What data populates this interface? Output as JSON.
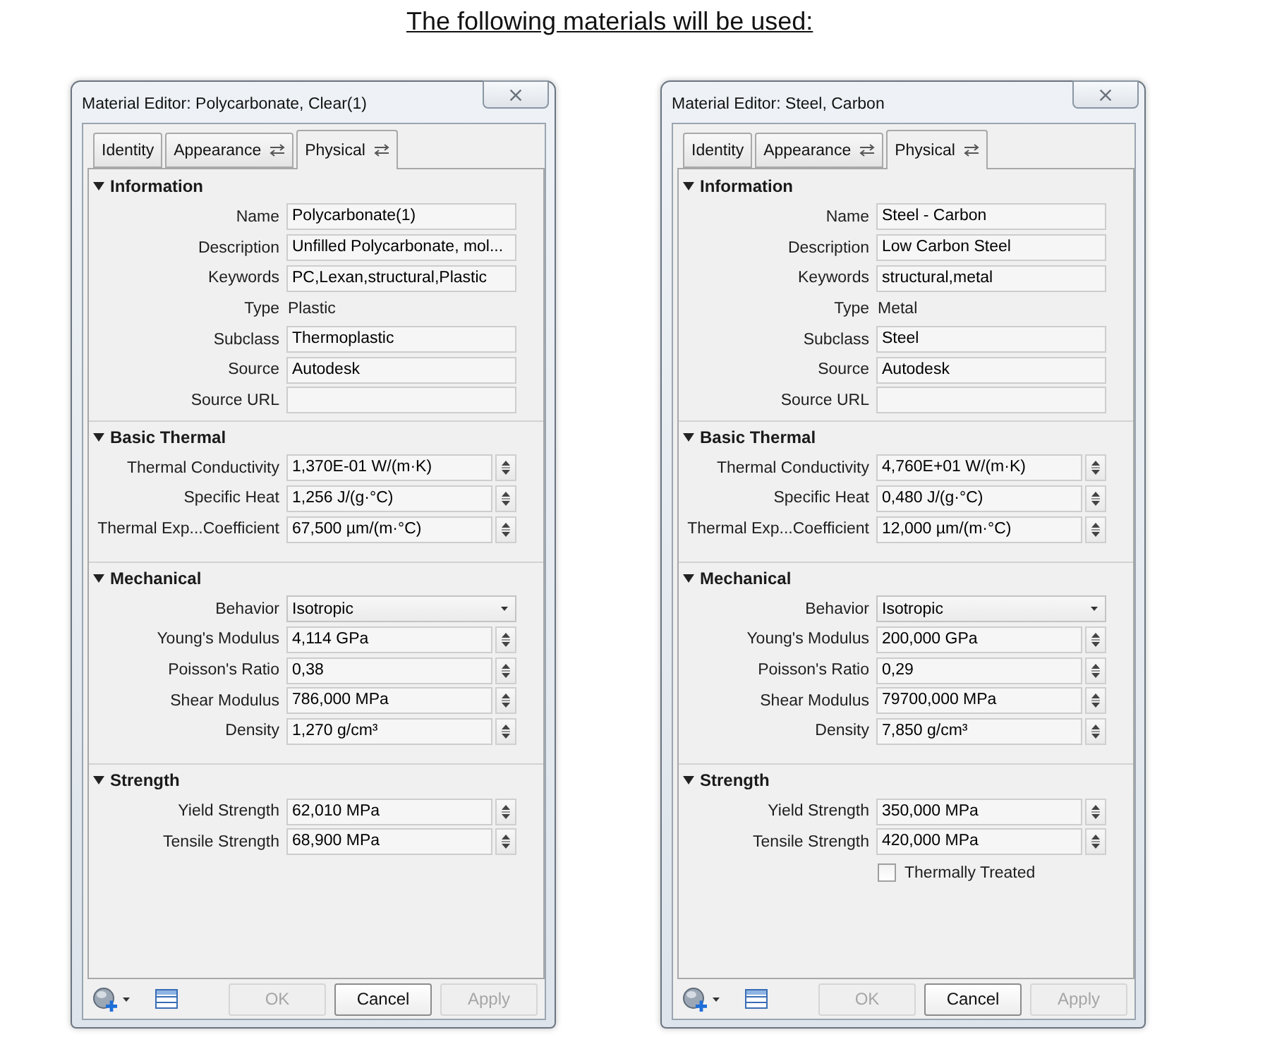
{
  "heading": "The following materials will be used:",
  "dialogs": [
    {
      "title": "Material Editor: Polycarbonate, Clear(1)",
      "tabs": [
        {
          "label": "Identity",
          "selected": false,
          "swap_icon": false
        },
        {
          "label": "Appearance",
          "selected": false,
          "swap_icon": true
        },
        {
          "label": "Physical",
          "selected": true,
          "swap_icon": true
        }
      ],
      "sections": [
        {
          "title": "Information",
          "expanded": true,
          "rows": [
            {
              "kind": "text",
              "label": "Name",
              "value": "Polycarbonate(1)"
            },
            {
              "kind": "text",
              "label": "Description",
              "value": "Unfilled Polycarbonate, mol..."
            },
            {
              "kind": "text",
              "label": "Keywords",
              "value": "PC,Lexan,structural,Plastic"
            },
            {
              "kind": "static",
              "label": "Type",
              "value": "Plastic"
            },
            {
              "kind": "text",
              "label": "Subclass",
              "value": "Thermoplastic"
            },
            {
              "kind": "text",
              "label": "Source",
              "value": "Autodesk"
            },
            {
              "kind": "text",
              "label": "Source URL"
            }
          ]
        },
        {
          "title": "Basic Thermal",
          "expanded": true,
          "rows": [
            {
              "kind": "spin",
              "label": "Thermal Conductivity",
              "value": "1,370E-01 W/(m·K)"
            },
            {
              "kind": "spin",
              "label": "Specific Heat",
              "value": "1,256 J/(g·°C)"
            },
            {
              "kind": "spin",
              "label": "Thermal Exp...Coefficient",
              "value": "67,500 µm/(m·°C)"
            }
          ]
        },
        {
          "title": "Mechanical",
          "expanded": true,
          "rows": [
            {
              "kind": "dropdown",
              "label": "Behavior",
              "value": "Isotropic"
            },
            {
              "kind": "spin",
              "label": "Young's Modulus",
              "value": "4,114 GPa"
            },
            {
              "kind": "spin",
              "label": "Poisson's Ratio",
              "value": "0,38"
            },
            {
              "kind": "spin",
              "label": "Shear Modulus",
              "value": "786,000 MPa"
            },
            {
              "kind": "spin",
              "label": "Density",
              "value": "1,270 g/cm³"
            }
          ]
        },
        {
          "title": "Strength",
          "expanded": true,
          "rows": [
            {
              "kind": "spin",
              "label": "Yield Strength",
              "value": "62,010 MPa"
            },
            {
              "kind": "spin",
              "label": "Tensile Strength",
              "value": "68,900 MPa"
            }
          ]
        }
      ],
      "buttons": [
        {
          "label": "OK",
          "disabled": true
        },
        {
          "label": "Cancel",
          "disabled": false
        },
        {
          "label": "Apply",
          "disabled": true
        }
      ]
    },
    {
      "title": "Material Editor: Steel, Carbon",
      "tabs": [
        {
          "label": "Identity",
          "selected": false,
          "swap_icon": false
        },
        {
          "label": "Appearance",
          "selected": false,
          "swap_icon": true
        },
        {
          "label": "Physical",
          "selected": true,
          "swap_icon": true
        }
      ],
      "sections": [
        {
          "title": "Information",
          "expanded": true,
          "rows": [
            {
              "kind": "text",
              "label": "Name",
              "value": "Steel - Carbon"
            },
            {
              "kind": "text",
              "label": "Description",
              "value": "Low Carbon Steel"
            },
            {
              "kind": "text",
              "label": "Keywords",
              "value": "structural,metal"
            },
            {
              "kind": "static",
              "label": "Type",
              "value": "Metal"
            },
            {
              "kind": "text",
              "label": "Subclass",
              "value": "Steel"
            },
            {
              "kind": "text",
              "label": "Source",
              "value": "Autodesk"
            },
            {
              "kind": "text",
              "label": "Source URL"
            }
          ]
        },
        {
          "title": "Basic Thermal",
          "expanded": true,
          "rows": [
            {
              "kind": "spin",
              "label": "Thermal Conductivity",
              "value": "4,760E+01 W/(m·K)"
            },
            {
              "kind": "spin",
              "label": "Specific Heat",
              "value": "0,480 J/(g·°C)"
            },
            {
              "kind": "spin",
              "label": "Thermal Exp...Coefficient",
              "value": "12,000 µm/(m·°C)"
            }
          ]
        },
        {
          "title": "Mechanical",
          "expanded": true,
          "rows": [
            {
              "kind": "dropdown",
              "label": "Behavior",
              "value": "Isotropic"
            },
            {
              "kind": "spin",
              "label": "Young's Modulus",
              "value": "200,000 GPa"
            },
            {
              "kind": "spin",
              "label": "Poisson's Ratio",
              "value": "0,29"
            },
            {
              "kind": "spin",
              "label": "Shear Modulus",
              "value": "79700,000 MPa"
            },
            {
              "kind": "spin",
              "label": "Density",
              "value": "7,850 g/cm³"
            }
          ]
        },
        {
          "title": "Strength",
          "expanded": true,
          "rows": [
            {
              "kind": "spin",
              "label": "Yield Strength",
              "value": "350,000 MPa"
            },
            {
              "kind": "spin",
              "label": "Tensile Strength",
              "value": "420,000 MPa"
            },
            {
              "kind": "checkbox",
              "label": "Thermally Treated",
              "checked": false
            }
          ]
        }
      ],
      "buttons": [
        {
          "label": "OK",
          "disabled": true
        },
        {
          "label": "Cancel",
          "disabled": false
        },
        {
          "label": "Apply",
          "disabled": true
        }
      ]
    }
  ]
}
